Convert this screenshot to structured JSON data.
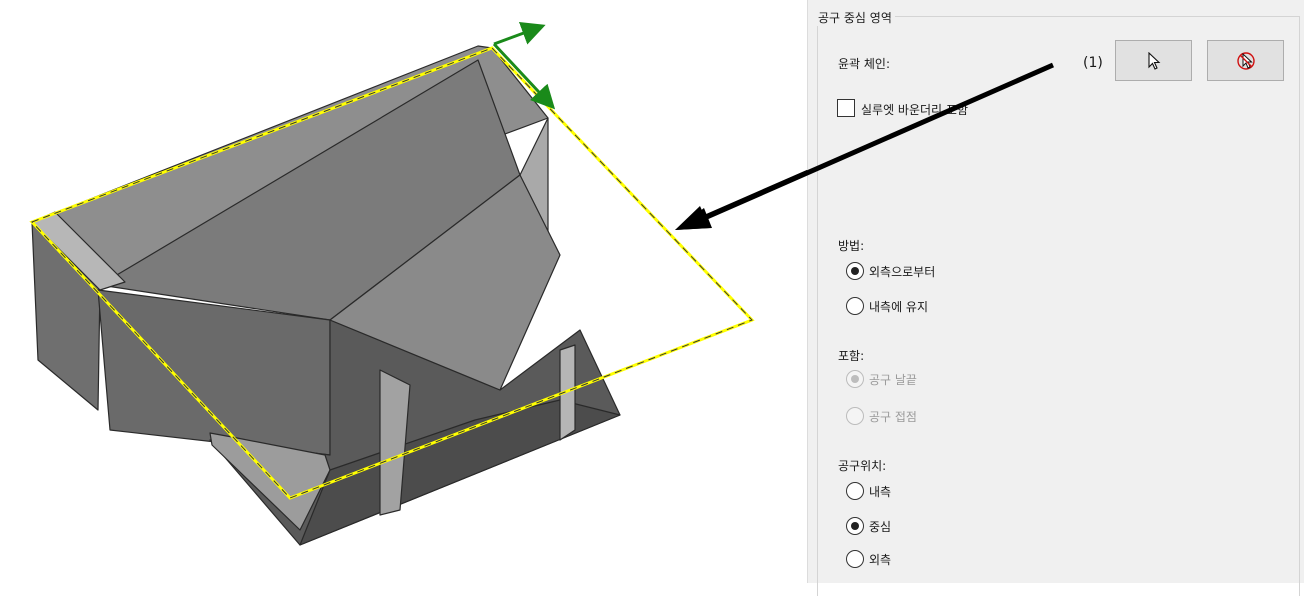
{
  "group_title": "공구 중심 영역",
  "contour_chain": {
    "label": "윤곽 체인:",
    "count": "(1)",
    "select_button_icon": "cursor-arrow-icon",
    "clear_button_icon": "cursor-cancel-icon"
  },
  "silhouette": {
    "label": "실루엣 바운더리 포함",
    "checked": false
  },
  "method": {
    "label": "방법:",
    "options": [
      {
        "label": "외측으로부터",
        "selected": true
      },
      {
        "label": "내측에 유지",
        "selected": false
      }
    ]
  },
  "include": {
    "label": "포함:",
    "disabled": true,
    "options": [
      {
        "label": "공구 날끝",
        "selected": true
      },
      {
        "label": "공구 접점",
        "selected": false
      }
    ]
  },
  "tool_position": {
    "label": "공구위치:",
    "options": [
      {
        "label": "내측",
        "selected": false
      },
      {
        "label": "중심",
        "selected": true
      },
      {
        "label": "외측",
        "selected": false
      }
    ]
  },
  "colors": {
    "boundary": "#ffff00",
    "axis": "#1a8a1a",
    "callout_arrow": "#000000",
    "model": "#8f8f8f"
  }
}
